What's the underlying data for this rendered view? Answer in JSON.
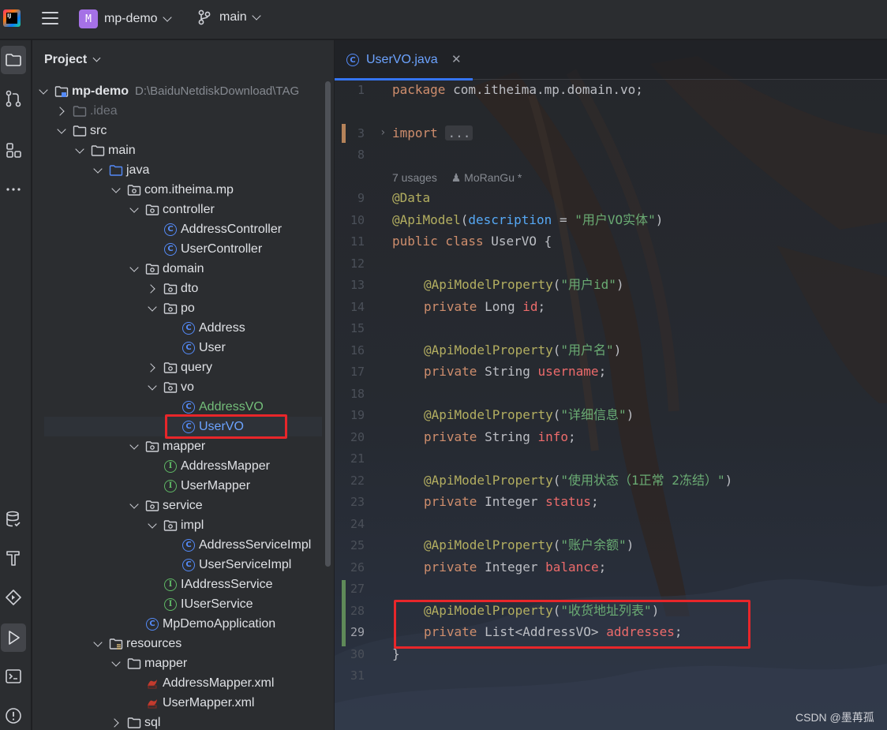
{
  "topbar": {
    "project_badge": "M",
    "project_name": "mp-demo",
    "branch_name": "main"
  },
  "project_panel": {
    "title": "Project",
    "root_name": "mp-demo",
    "root_path": "D:\\BaiduNetdiskDownload\\TAG",
    "items": [
      {
        "label": "mp-demo"
      },
      {
        "label": ".idea"
      },
      {
        "label": "src"
      },
      {
        "label": "main"
      },
      {
        "label": "java"
      },
      {
        "label": "com.itheima.mp"
      },
      {
        "label": "controller"
      },
      {
        "label": "AddressController"
      },
      {
        "label": "UserController"
      },
      {
        "label": "domain"
      },
      {
        "label": "dto"
      },
      {
        "label": "po"
      },
      {
        "label": "Address"
      },
      {
        "label": "User"
      },
      {
        "label": "query"
      },
      {
        "label": "vo"
      },
      {
        "label": "AddressVO"
      },
      {
        "label": "UserVO"
      },
      {
        "label": "mapper"
      },
      {
        "label": "AddressMapper"
      },
      {
        "label": "UserMapper"
      },
      {
        "label": "service"
      },
      {
        "label": "impl"
      },
      {
        "label": "AddressServiceImpl"
      },
      {
        "label": "UserServiceImpl"
      },
      {
        "label": "IAddressService"
      },
      {
        "label": "IUserService"
      },
      {
        "label": "MpDemoApplication"
      },
      {
        "label": "resources"
      },
      {
        "label": "mapper"
      },
      {
        "label": "AddressMapper.xml"
      },
      {
        "label": "UserMapper.xml"
      },
      {
        "label": "sql"
      }
    ]
  },
  "editor": {
    "tab_label": "UserVO.java",
    "tab_close": "✕",
    "line_numbers": [
      "1",
      "3",
      "8",
      "9",
      "10",
      "11",
      "12",
      "13",
      "14",
      "15",
      "16",
      "17",
      "18",
      "19",
      "20",
      "21",
      "22",
      "23",
      "24",
      "25",
      "26",
      "27",
      "28",
      "29",
      "30",
      "31"
    ],
    "fold_arrow": "›",
    "usages_hint": "7 usages",
    "author_hint": "MoRanGu *",
    "code": {
      "l1_kw": "package",
      "l1_rest": " com.itheima.mp.domain.vo;",
      "l3_kw": "import",
      "l3_collapsed": "...",
      "l9": "@Data",
      "l10_an": "@ApiModel",
      "l10_open": "(",
      "l10_param": "description",
      "l10_eq": " = ",
      "l10_str": "\"用户VO实体\"",
      "l10_close": ")",
      "l11_kw": "public class",
      "l11_rest": " UserVO {",
      "ann": "@ApiModelProperty",
      "l13_str": "\"用户id\"",
      "l14_kw": "private",
      "l14_type": " Long ",
      "l14_field": "id",
      "l16_str": "\"用户名\"",
      "l17_type": " String ",
      "l17_field": "username",
      "l19_str": "\"详细信息\"",
      "l20_type": " String ",
      "l20_field": "info",
      "l22_str": "\"使用状态（1正常 2冻结）\"",
      "l23_type": " Integer ",
      "l23_field": "status",
      "l25_str": "\"账户余额\"",
      "l26_type": " Integer ",
      "l26_field": "balance",
      "l28_str": "\"收货地址列表\"",
      "l29_type": " List<AddressVO> ",
      "l29_field": "addresses",
      "open_paren": "(",
      "close_paren": ")",
      "semicolon": ";",
      "l30": "}"
    }
  },
  "watermark": "CSDN @墨苒孤"
}
